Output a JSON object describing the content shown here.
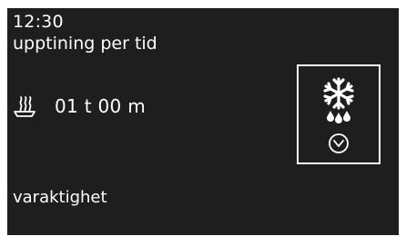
{
  "status": {
    "clock": "12:30"
  },
  "program": {
    "name": "upptining per tid",
    "icon": "defrost-by-time-icon"
  },
  "duration": {
    "icon": "food-dish-icon",
    "value": "01 t 00 m"
  },
  "field": {
    "label": "varaktighet"
  }
}
